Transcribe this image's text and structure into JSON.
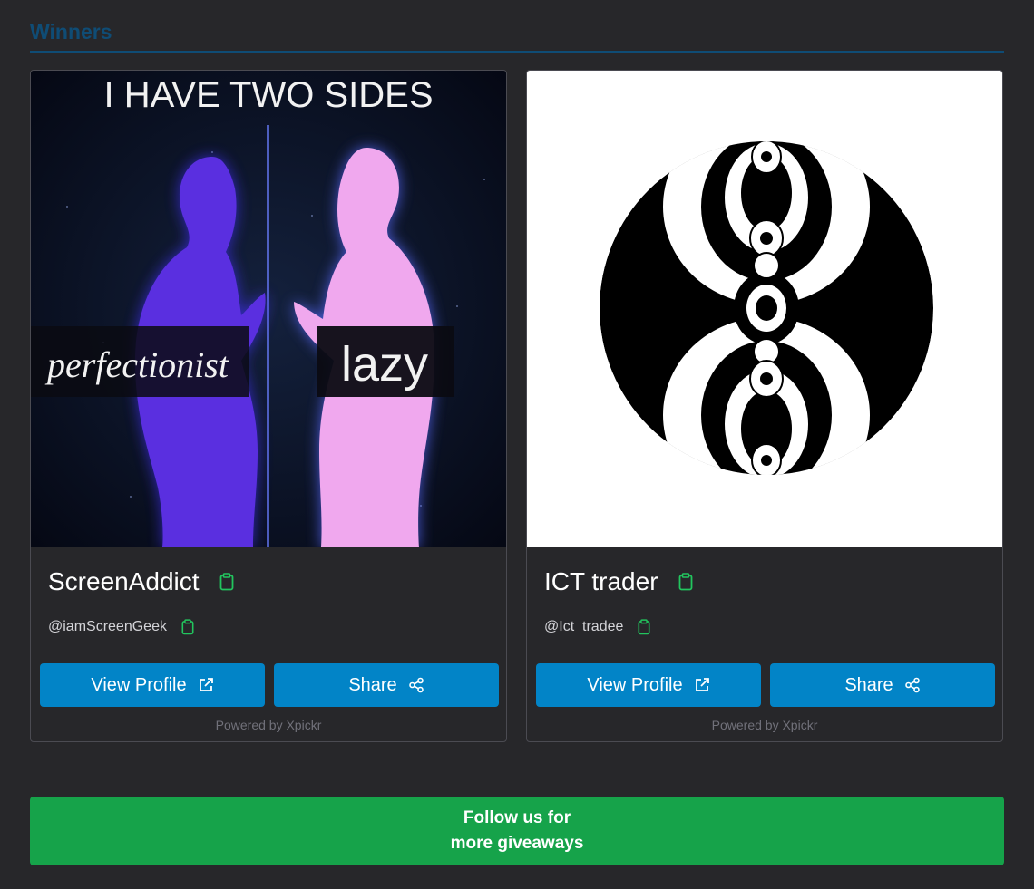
{
  "section": {
    "title": "Winners"
  },
  "winners": [
    {
      "display_name": "ScreenAddict",
      "handle": "@iamScreenGeek",
      "image": {
        "caption_top": "I HAVE TWO SIDES",
        "label_left": "perfectionist",
        "label_right": "lazy"
      },
      "view_profile_label": "View Profile",
      "share_label": "Share",
      "powered_by": "Powered by Xpickr"
    },
    {
      "display_name": "ICT trader",
      "handle": "@Ict_tradee",
      "view_profile_label": "View Profile",
      "share_label": "Share",
      "powered_by": "Powered by Xpickr"
    }
  ],
  "follow": {
    "line1": "Follow us for",
    "line2": "more giveaways"
  },
  "colors": {
    "background": "#27272a",
    "heading": "#0f4c75",
    "button_blue": "#0284c7",
    "button_green": "#16a34a",
    "clipboard_icon": "#22c55e"
  },
  "icons": {
    "copy": "clipboard-icon",
    "external": "external-link-icon",
    "share": "share-icon"
  }
}
